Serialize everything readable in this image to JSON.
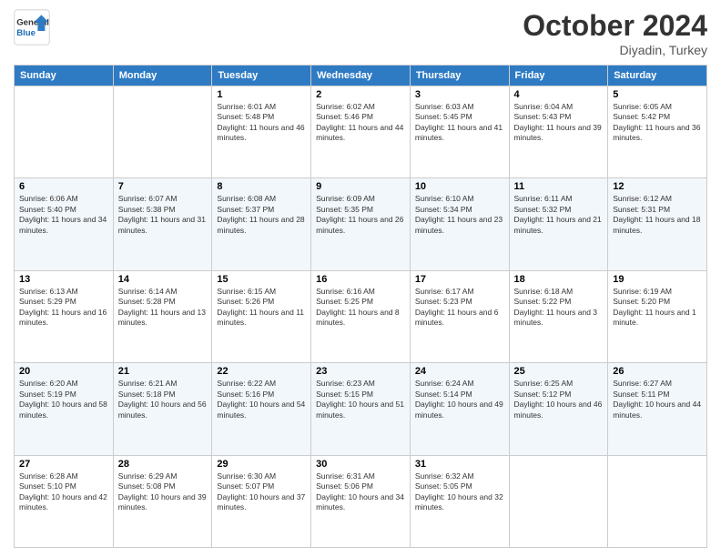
{
  "header": {
    "logo_line1": "General",
    "logo_line2": "Blue",
    "month_title": "October 2024",
    "location": "Diyadin, Turkey"
  },
  "days_of_week": [
    "Sunday",
    "Monday",
    "Tuesday",
    "Wednesday",
    "Thursday",
    "Friday",
    "Saturday"
  ],
  "weeks": [
    [
      {
        "day": "",
        "info": ""
      },
      {
        "day": "",
        "info": ""
      },
      {
        "day": "1",
        "info": "Sunrise: 6:01 AM\nSunset: 5:48 PM\nDaylight: 11 hours and 46 minutes."
      },
      {
        "day": "2",
        "info": "Sunrise: 6:02 AM\nSunset: 5:46 PM\nDaylight: 11 hours and 44 minutes."
      },
      {
        "day": "3",
        "info": "Sunrise: 6:03 AM\nSunset: 5:45 PM\nDaylight: 11 hours and 41 minutes."
      },
      {
        "day": "4",
        "info": "Sunrise: 6:04 AM\nSunset: 5:43 PM\nDaylight: 11 hours and 39 minutes."
      },
      {
        "day": "5",
        "info": "Sunrise: 6:05 AM\nSunset: 5:42 PM\nDaylight: 11 hours and 36 minutes."
      }
    ],
    [
      {
        "day": "6",
        "info": "Sunrise: 6:06 AM\nSunset: 5:40 PM\nDaylight: 11 hours and 34 minutes."
      },
      {
        "day": "7",
        "info": "Sunrise: 6:07 AM\nSunset: 5:38 PM\nDaylight: 11 hours and 31 minutes."
      },
      {
        "day": "8",
        "info": "Sunrise: 6:08 AM\nSunset: 5:37 PM\nDaylight: 11 hours and 28 minutes."
      },
      {
        "day": "9",
        "info": "Sunrise: 6:09 AM\nSunset: 5:35 PM\nDaylight: 11 hours and 26 minutes."
      },
      {
        "day": "10",
        "info": "Sunrise: 6:10 AM\nSunset: 5:34 PM\nDaylight: 11 hours and 23 minutes."
      },
      {
        "day": "11",
        "info": "Sunrise: 6:11 AM\nSunset: 5:32 PM\nDaylight: 11 hours and 21 minutes."
      },
      {
        "day": "12",
        "info": "Sunrise: 6:12 AM\nSunset: 5:31 PM\nDaylight: 11 hours and 18 minutes."
      }
    ],
    [
      {
        "day": "13",
        "info": "Sunrise: 6:13 AM\nSunset: 5:29 PM\nDaylight: 11 hours and 16 minutes."
      },
      {
        "day": "14",
        "info": "Sunrise: 6:14 AM\nSunset: 5:28 PM\nDaylight: 11 hours and 13 minutes."
      },
      {
        "day": "15",
        "info": "Sunrise: 6:15 AM\nSunset: 5:26 PM\nDaylight: 11 hours and 11 minutes."
      },
      {
        "day": "16",
        "info": "Sunrise: 6:16 AM\nSunset: 5:25 PM\nDaylight: 11 hours and 8 minutes."
      },
      {
        "day": "17",
        "info": "Sunrise: 6:17 AM\nSunset: 5:23 PM\nDaylight: 11 hours and 6 minutes."
      },
      {
        "day": "18",
        "info": "Sunrise: 6:18 AM\nSunset: 5:22 PM\nDaylight: 11 hours and 3 minutes."
      },
      {
        "day": "19",
        "info": "Sunrise: 6:19 AM\nSunset: 5:20 PM\nDaylight: 11 hours and 1 minute."
      }
    ],
    [
      {
        "day": "20",
        "info": "Sunrise: 6:20 AM\nSunset: 5:19 PM\nDaylight: 10 hours and 58 minutes."
      },
      {
        "day": "21",
        "info": "Sunrise: 6:21 AM\nSunset: 5:18 PM\nDaylight: 10 hours and 56 minutes."
      },
      {
        "day": "22",
        "info": "Sunrise: 6:22 AM\nSunset: 5:16 PM\nDaylight: 10 hours and 54 minutes."
      },
      {
        "day": "23",
        "info": "Sunrise: 6:23 AM\nSunset: 5:15 PM\nDaylight: 10 hours and 51 minutes."
      },
      {
        "day": "24",
        "info": "Sunrise: 6:24 AM\nSunset: 5:14 PM\nDaylight: 10 hours and 49 minutes."
      },
      {
        "day": "25",
        "info": "Sunrise: 6:25 AM\nSunset: 5:12 PM\nDaylight: 10 hours and 46 minutes."
      },
      {
        "day": "26",
        "info": "Sunrise: 6:27 AM\nSunset: 5:11 PM\nDaylight: 10 hours and 44 minutes."
      }
    ],
    [
      {
        "day": "27",
        "info": "Sunrise: 6:28 AM\nSunset: 5:10 PM\nDaylight: 10 hours and 42 minutes."
      },
      {
        "day": "28",
        "info": "Sunrise: 6:29 AM\nSunset: 5:08 PM\nDaylight: 10 hours and 39 minutes."
      },
      {
        "day": "29",
        "info": "Sunrise: 6:30 AM\nSunset: 5:07 PM\nDaylight: 10 hours and 37 minutes."
      },
      {
        "day": "30",
        "info": "Sunrise: 6:31 AM\nSunset: 5:06 PM\nDaylight: 10 hours and 34 minutes."
      },
      {
        "day": "31",
        "info": "Sunrise: 6:32 AM\nSunset: 5:05 PM\nDaylight: 10 hours and 32 minutes."
      },
      {
        "day": "",
        "info": ""
      },
      {
        "day": "",
        "info": ""
      }
    ]
  ]
}
